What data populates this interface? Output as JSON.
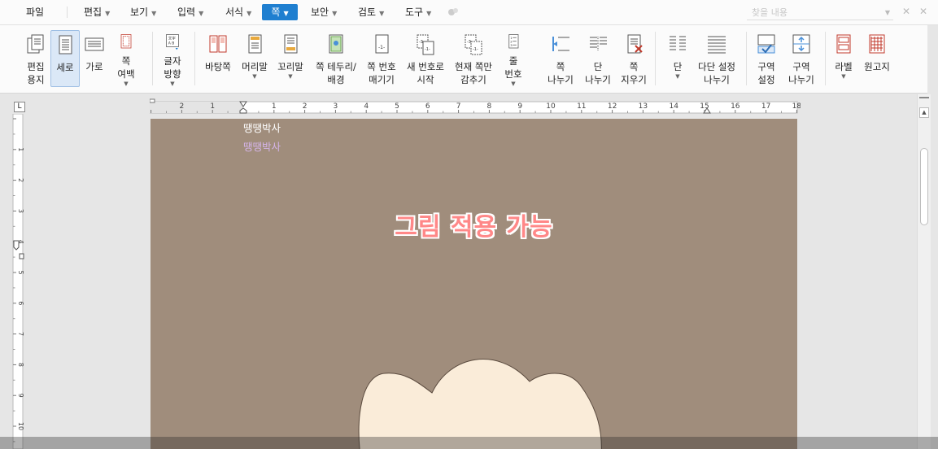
{
  "menu": {
    "file": "파일",
    "items": [
      {
        "label": "편집"
      },
      {
        "label": "보기"
      },
      {
        "label": "입력"
      },
      {
        "label": "서식"
      },
      {
        "label": "쪽",
        "active": true
      },
      {
        "label": "보안"
      },
      {
        "label": "검토"
      },
      {
        "label": "도구"
      }
    ],
    "search_placeholder": "찾을 내용",
    "accent_color": "#1f7fd0"
  },
  "ribbon": {
    "buttons": [
      {
        "name": "edit-paper",
        "label": "편집\n용지",
        "icon": "paper-icon"
      },
      {
        "name": "portrait",
        "label": "세로",
        "icon": "portrait-page-icon",
        "selected": true
      },
      {
        "name": "landscape",
        "label": "가로",
        "icon": "landscape-page-icon"
      },
      {
        "name": "page-margin",
        "label": "쪽\n여백",
        "icon": "margin-icon",
        "dropdown": true
      },
      {
        "name": "text-direction",
        "label": "글자\n방향",
        "icon": "text-direction-icon",
        "dropdown": true
      },
      {
        "name": "background-page",
        "label": "바탕쪽",
        "icon": "background-page-icon"
      },
      {
        "name": "header",
        "label": "머리말",
        "icon": "header-icon",
        "dropdown": true
      },
      {
        "name": "footer",
        "label": "꼬리말",
        "icon": "footer-icon",
        "dropdown": true
      },
      {
        "name": "page-border",
        "label": "쪽 테두리/\n배경",
        "icon": "page-border-icon"
      },
      {
        "name": "page-numbering",
        "label": "쪽 번호\n매기기",
        "icon": "page-number-icon"
      },
      {
        "name": "new-number-start",
        "label": "새 번호로\n시작",
        "icon": "new-number-icon"
      },
      {
        "name": "hide-current-page",
        "label": "현재 쪽만\n감추기",
        "icon": "hide-page-icon"
      },
      {
        "name": "line-number",
        "label": "줄\n번호",
        "icon": "line-number-icon",
        "dropdown": true
      },
      {
        "name": "page-break",
        "label": "쪽\n나누기",
        "icon": "page-break-icon"
      },
      {
        "name": "column-break",
        "label": "단\n나누기",
        "icon": "column-break-icon"
      },
      {
        "name": "delete-page",
        "label": "쪽\n지우기",
        "icon": "delete-page-icon"
      },
      {
        "name": "columns",
        "label": "단",
        "icon": "columns-icon",
        "dropdown": true
      },
      {
        "name": "multi-column-break",
        "label": "다단 설정\n나누기",
        "icon": "multi-column-icon"
      },
      {
        "name": "section-setup",
        "label": "구역\n설정",
        "icon": "section-setup-icon"
      },
      {
        "name": "section-break",
        "label": "구역\n나누기",
        "icon": "section-break-icon"
      },
      {
        "name": "label",
        "label": "라벨",
        "icon": "label-icon",
        "dropdown": true
      },
      {
        "name": "manuscript-paper",
        "label": "원고지",
        "icon": "manuscript-icon"
      }
    ]
  },
  "ruler": {
    "corner_label": "L",
    "h_left_labels": [
      "2",
      "1"
    ],
    "h_right_labels": [
      "1",
      "2",
      "3",
      "4",
      "5",
      "6",
      "7",
      "8",
      "9",
      "10",
      "11",
      "12",
      "13",
      "14",
      "15",
      "16",
      "17",
      "18"
    ],
    "v_labels": [
      "1",
      "2",
      "3",
      "4",
      "5",
      "6",
      "7",
      "8",
      "9",
      "10",
      "11"
    ]
  },
  "document": {
    "header_line_1": "땡땡박사",
    "header_line_2": "땡땡박사",
    "title": "그림 적용 가능",
    "background_color": "#a08d7c",
    "title_color": "#ff8888"
  }
}
